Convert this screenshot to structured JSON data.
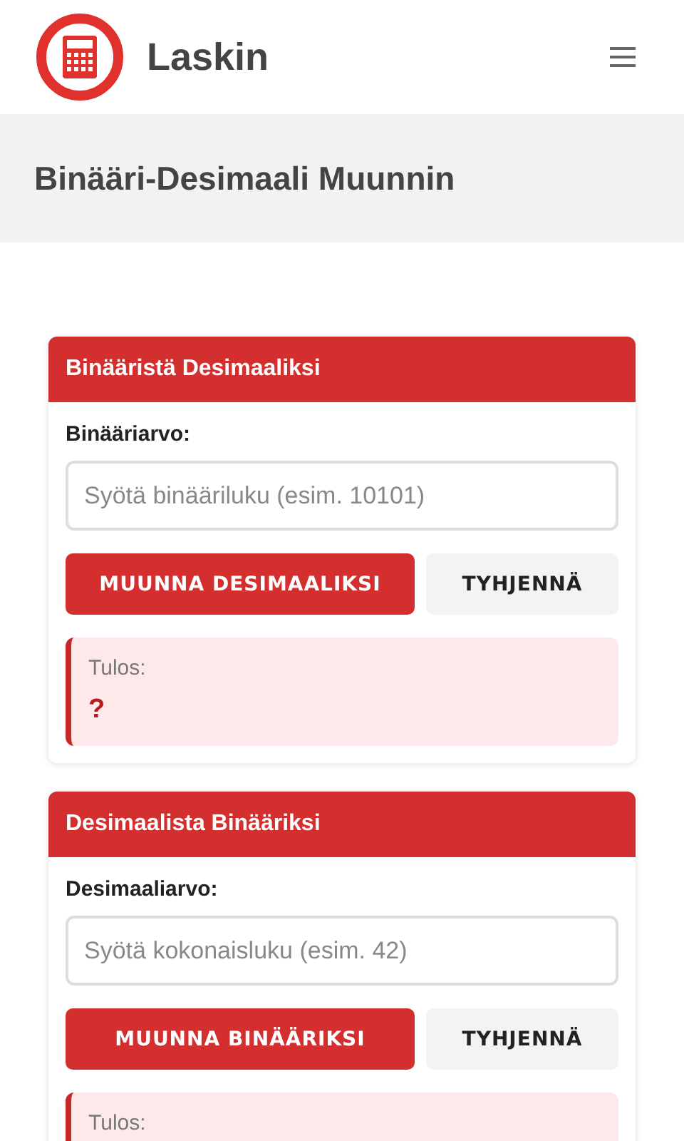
{
  "header": {
    "title": "Laskin"
  },
  "page_title": "Binääri-Desimaali Muunnin",
  "cards": [
    {
      "title": "Binääristä Desimaaliksi",
      "field_label": "Binääriarvo:",
      "placeholder": "Syötä binääriluku (esim. 10101)",
      "buttons": [
        {
          "label": "MUUNNA DESIMAALIKSI",
          "kind": "primary"
        },
        {
          "label": "TYHJENNÄ",
          "kind": "secondary"
        }
      ],
      "result": {
        "label": "Tulos:",
        "value": "?"
      }
    },
    {
      "title": "Desimaalista Binääriksi",
      "field_label": "Desimaaliarvo:",
      "placeholder": "Syötä kokonaisluku (esim. 42)",
      "buttons": [
        {
          "label": "MUUNNA BINÄÄRIKSI",
          "kind": "primary"
        },
        {
          "label": "TYHJENNÄ",
          "kind": "secondary"
        }
      ],
      "result": {
        "label": "Tulos:"
      }
    }
  ]
}
